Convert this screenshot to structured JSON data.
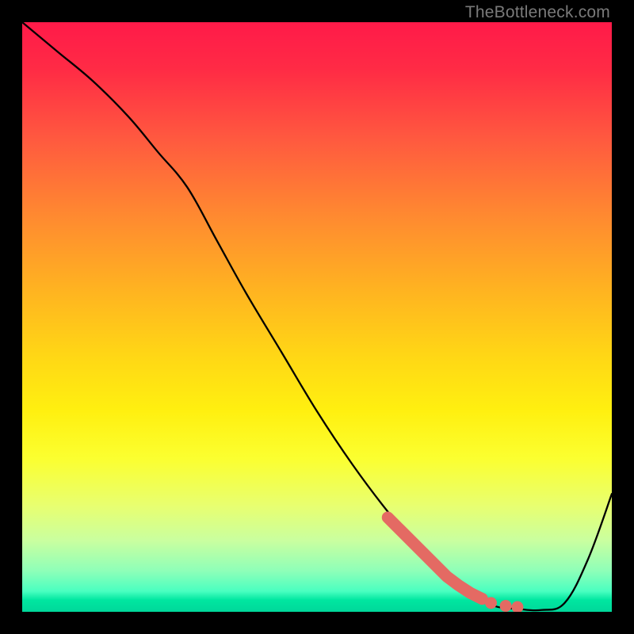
{
  "watermark": "TheBottleneck.com",
  "chart_data": {
    "type": "line",
    "title": "",
    "xlabel": "",
    "ylabel": "",
    "xlim": [
      0,
      100
    ],
    "ylim": [
      0,
      100
    ],
    "series": [
      {
        "name": "curve",
        "x": [
          0,
          6,
          12,
          18,
          23,
          28,
          33,
          38,
          44,
          50,
          56,
          62,
          68,
          72,
          76,
          80,
          84,
          88,
          92,
          96,
          100
        ],
        "values": [
          100,
          95,
          90,
          84,
          78,
          72,
          63,
          54,
          44,
          34,
          25,
          17,
          10,
          6,
          3,
          1,
          0.5,
          0.3,
          1.5,
          9,
          20
        ]
      }
    ],
    "highlight": {
      "name": "scatter-points",
      "x": [
        62,
        64,
        66,
        68,
        70,
        72,
        74,
        76,
        78,
        79.5,
        82,
        84
      ],
      "values": [
        16,
        14,
        12,
        10,
        8,
        6,
        4.5,
        3.2,
        2.2,
        1.5,
        1,
        0.8
      ]
    }
  }
}
